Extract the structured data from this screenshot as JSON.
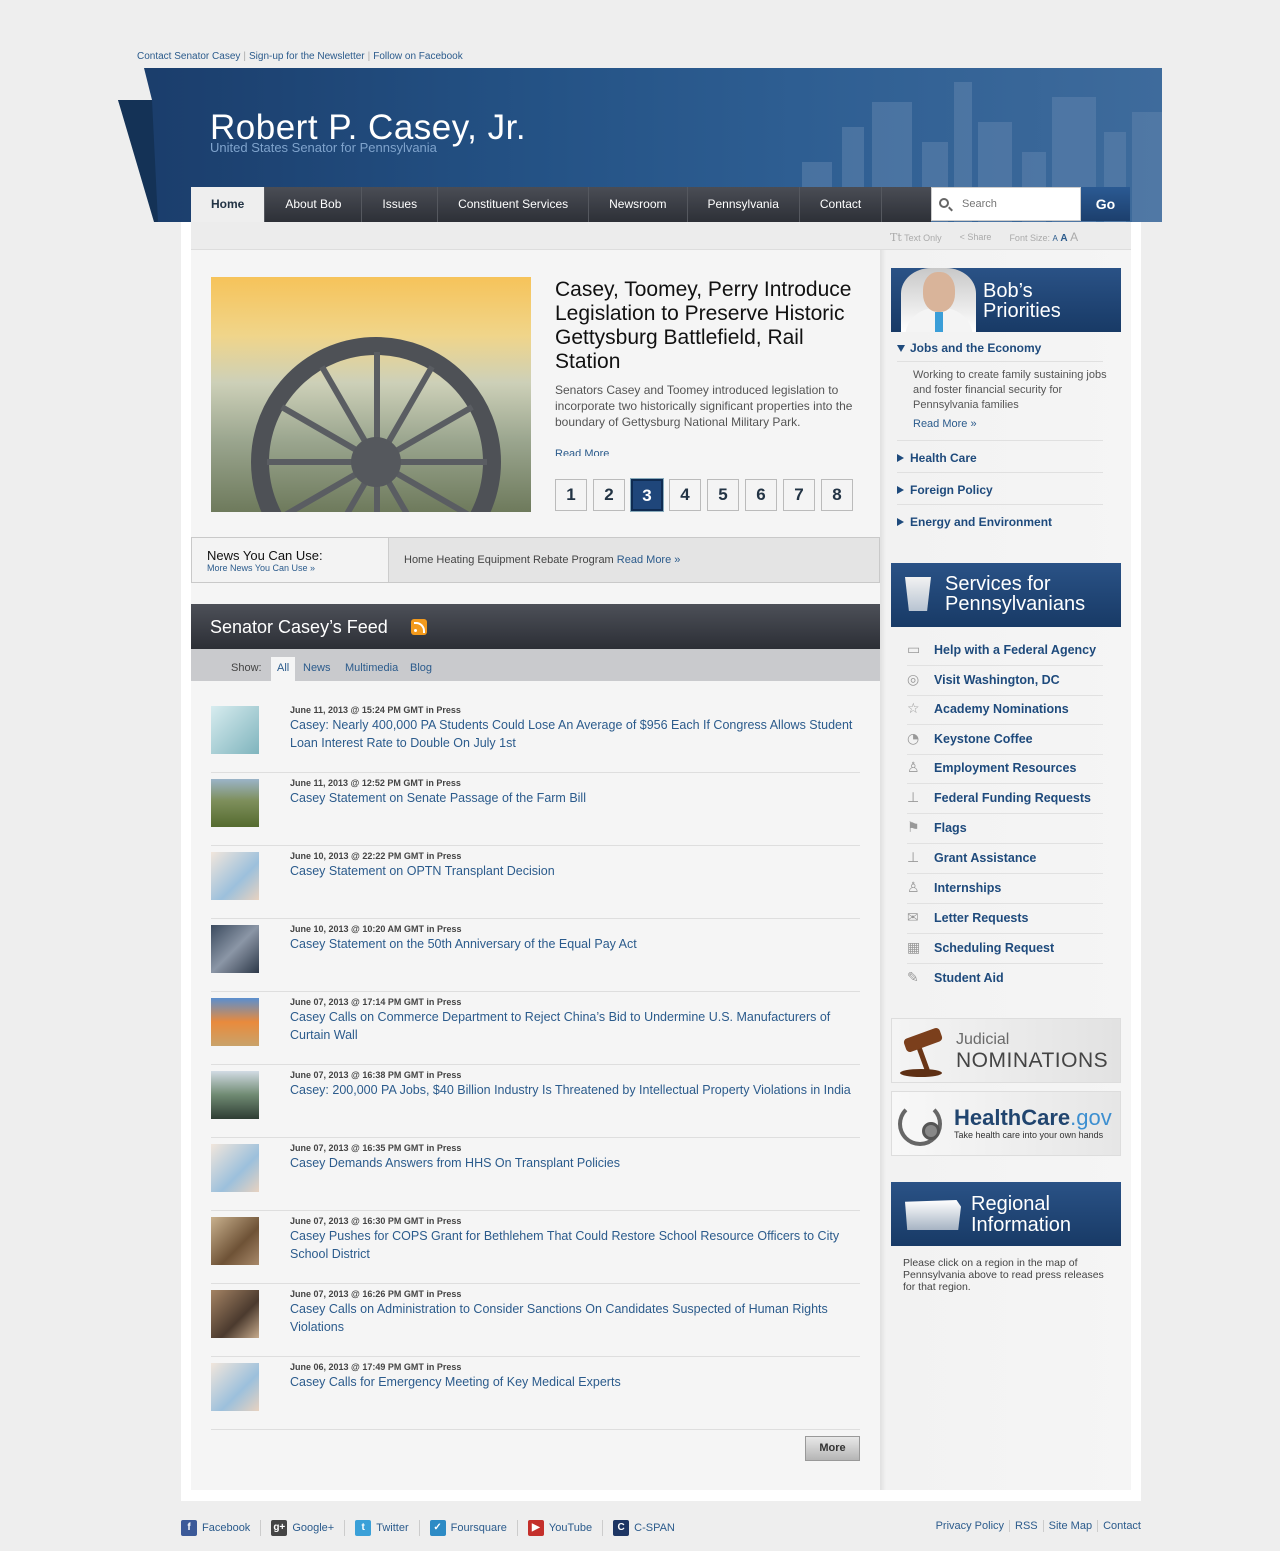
{
  "toplinks": [
    "Contact Senator Casey",
    "Sign-up for the Newsletter",
    "Follow on Facebook"
  ],
  "header": {
    "title": "Robert P. Casey, Jr.",
    "subtitle": "United States Senator for Pennsylvania"
  },
  "nav": [
    "Home",
    "About Bob",
    "Issues",
    "Constituent Services",
    "Newsroom",
    "Pennsylvania",
    "Contact"
  ],
  "search": {
    "placeholder": "Search",
    "go": "Go"
  },
  "tools": {
    "text_only": "Text Only",
    "share": "Share",
    "font_size": "Font Size:",
    "sizes": [
      "A",
      "A",
      "A"
    ]
  },
  "hero": {
    "title": "Casey, Toomey, Perry Introduce Legislation to Preserve Historic Gettysburg Battlefield, Rail Station",
    "desc": "Senators Casey and Toomey introduced legislation to incorporate two historically significant properties into the boundary of Gettysburg National Military Park.",
    "more": "Read More",
    "pages": [
      "1",
      "2",
      "3",
      "4",
      "5",
      "6",
      "7",
      "8"
    ],
    "active_page": "3"
  },
  "news_you_can_use": {
    "label": "News You Can Use:",
    "more": "More News You Can Use »",
    "item": "Home Heating Equipment Rebate Program",
    "item_link": "Read More »"
  },
  "feed": {
    "title": "Senator Casey’s Feed",
    "show_label": "Show:",
    "filters": [
      "All",
      "News",
      "Multimedia",
      "Blog"
    ],
    "items": [
      {
        "meta": "June 11, 2013 @ 15:24 PM GMT in Press",
        "title": "Casey: Nearly 400,000 PA Students Could Lose An Average of $956 Each If Congress Allows Student Loan Interest Rate to Double On July 1st"
      },
      {
        "meta": "June 11, 2013 @ 12:52 PM GMT in Press",
        "title": "Casey Statement on Senate Passage of the Farm Bill"
      },
      {
        "meta": "June 10, 2013 @ 22:22 PM GMT in Press",
        "title": "Casey Statement on OPTN Transplant Decision"
      },
      {
        "meta": "June 10, 2013 @ 10:20 AM GMT in Press",
        "title": "Casey Statement on the 50th Anniversary of the Equal Pay Act"
      },
      {
        "meta": "June 07, 2013 @ 17:14 PM GMT in Press",
        "title": "Casey Calls on Commerce Department to Reject China’s Bid to Undermine U.S. Manufacturers of Curtain Wall"
      },
      {
        "meta": "June 07, 2013 @ 16:38 PM GMT in Press",
        "title": "Casey: 200,000 PA Jobs, $40 Billion Industry Is Threatened by Intellectual Property Violations in India"
      },
      {
        "meta": "June 07, 2013 @ 16:35 PM GMT in Press",
        "title": "Casey Demands Answers from HHS On Transplant Policies"
      },
      {
        "meta": "June 07, 2013 @ 16:30 PM GMT in Press",
        "title": "Casey Pushes for COPS Grant for Bethlehem That Could Restore School Resource Officers to City School District"
      },
      {
        "meta": "June 07, 2013 @ 16:26 PM GMT in Press",
        "title": "Casey Calls on Administration to Consider Sanctions On Candidates Suspected of Human Rights Violations"
      },
      {
        "meta": "June 06, 2013 @ 17:49 PM GMT in Press",
        "title": "Casey Calls for Emergency Meeting of Key Medical Experts"
      }
    ],
    "more": "More"
  },
  "priorities": {
    "title_line1": "Bob’s",
    "title_line2": "Priorities",
    "items": [
      "Jobs and the Economy",
      "Health Care",
      "Foreign Policy",
      "Energy and Environment"
    ],
    "open_desc": "Working to create family sustaining jobs and foster financial security for Pennsylvania families",
    "read_more": "Read More »"
  },
  "services": {
    "title_line1": "Services for",
    "title_line2": "Pennsylvanians",
    "items": [
      {
        "label": "Help with a Federal Agency",
        "icon": "folder-icon"
      },
      {
        "label": "Visit Washington, DC",
        "icon": "globe-icon"
      },
      {
        "label": "Academy Nominations",
        "icon": "star-icon"
      },
      {
        "label": "Keystone Coffee",
        "icon": "clock-icon"
      },
      {
        "label": "Employment Resources",
        "icon": "person-icon"
      },
      {
        "label": "Federal Funding Requests",
        "icon": "stamp-icon"
      },
      {
        "label": "Flags",
        "icon": "flag-icon"
      },
      {
        "label": "Grant Assistance",
        "icon": "stamp-icon"
      },
      {
        "label": "Internships",
        "icon": "person-icon"
      },
      {
        "label": "Letter Requests",
        "icon": "envelope-icon"
      },
      {
        "label": "Scheduling Request",
        "icon": "calendar-icon"
      },
      {
        "label": "Student Aid",
        "icon": "pencil-icon"
      }
    ]
  },
  "judicial": {
    "line1": "Judicial",
    "line2": "NOMINATIONS"
  },
  "healthcare": {
    "brand": "HealthCare",
    "tld": ".gov",
    "tagline": "Take health care into your own hands"
  },
  "regional": {
    "title_line1": "Regional",
    "title_line2": "Information",
    "text": "Please click on a region in the map of Pennsylvania above to read press releases for that region."
  },
  "footer": {
    "social": [
      {
        "label": "Facebook",
        "color": "#3b5998",
        "glyph": "f"
      },
      {
        "label": "Google+",
        "color": "#444444",
        "glyph": "g+"
      },
      {
        "label": "Twitter",
        "color": "#3aa0d8",
        "glyph": "t"
      },
      {
        "label": "Foursquare",
        "color": "#2d8bc5",
        "glyph": "✓"
      },
      {
        "label": "YouTube",
        "color": "#c4302b",
        "glyph": "▶"
      },
      {
        "label": "C-SPAN",
        "color": "#1d3563",
        "glyph": "C"
      }
    ],
    "links": [
      "Privacy Policy",
      "RSS",
      "Site Map",
      "Contact"
    ]
  }
}
